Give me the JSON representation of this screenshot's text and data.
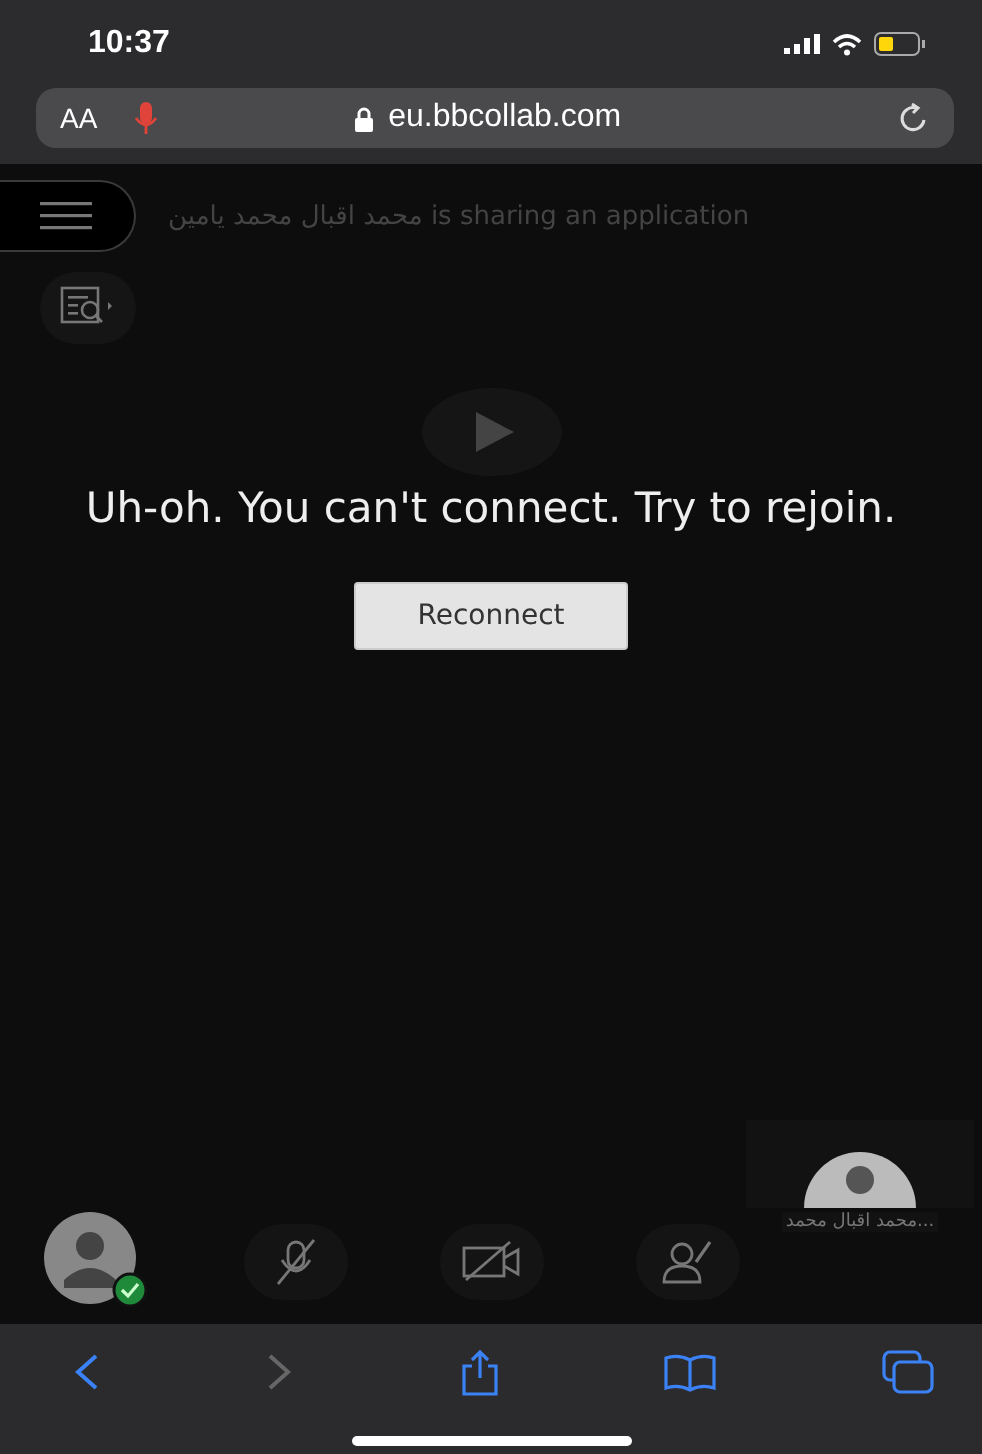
{
  "status_bar": {
    "time": "10:37"
  },
  "address_bar": {
    "text_size_label": "AA",
    "microphone_active": true,
    "secure": true,
    "url": "eu.bbcollab.com"
  },
  "session": {
    "sharing_name": "محمد اقبال محمد يامين",
    "sharing_text": "is sharing an application",
    "message": "Uh-oh. You can't connect. Try to rejoin.",
    "button": "Reconnect"
  },
  "participant_tile": {
    "name": "محمد اقبال محمد..."
  },
  "controls": {
    "status_ok": true,
    "microphone_muted": true,
    "camera_off": true
  },
  "browser_toolbar": {
    "back_disabled": false,
    "forward_disabled": true
  }
}
